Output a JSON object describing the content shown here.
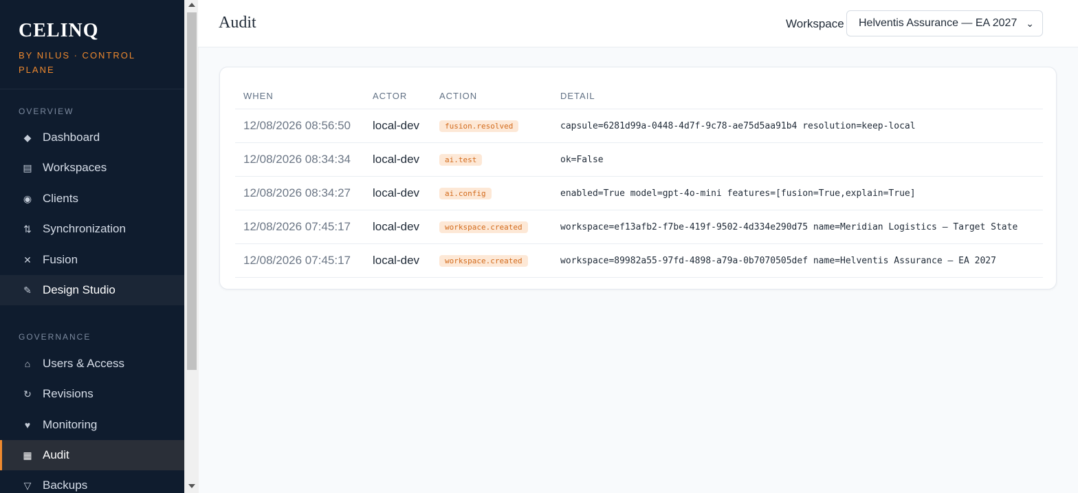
{
  "brand": {
    "title": "CELINQ",
    "subtitle": "BY NILUS · CONTROL PLANE"
  },
  "sidebar": {
    "overview_label": "OVERVIEW",
    "overview_items": [
      {
        "label": "Dashboard",
        "icon": "diamond-icon"
      },
      {
        "label": "Workspaces",
        "icon": "list-icon"
      },
      {
        "label": "Clients",
        "icon": "radio-icon"
      },
      {
        "label": "Synchronization",
        "icon": "sync-arrows-icon"
      },
      {
        "label": "Fusion",
        "icon": "cross-icon"
      },
      {
        "label": "Design Studio",
        "icon": "pencil-icon"
      }
    ],
    "governance_label": "GOVERNANCE",
    "governance_items": [
      {
        "label": "Users & Access",
        "icon": "home-icon"
      },
      {
        "label": "Revisions",
        "icon": "refresh-icon"
      },
      {
        "label": "Monitoring",
        "icon": "heart-icon"
      },
      {
        "label": "Audit",
        "icon": "grid-icon"
      },
      {
        "label": "Backups",
        "icon": "triangle-down-icon"
      }
    ],
    "active_item": "Audit",
    "accent_color": "#f08a2e"
  },
  "header": {
    "title": "Audit",
    "workspace_label": "Workspace",
    "workspace_value": "Helventis Assurance — EA 2027"
  },
  "table": {
    "columns": [
      "WHEN",
      "ACTOR",
      "ACTION",
      "DETAIL"
    ],
    "rows": [
      {
        "when": "12/08/2026 08:56:50",
        "actor": "local-dev",
        "action": "fusion.resolved",
        "detail": "capsule=6281d99a-0448-4d7f-9c78-ae75d5aa91b4 resolution=keep-local"
      },
      {
        "when": "12/08/2026 08:34:34",
        "actor": "local-dev",
        "action": "ai.test",
        "detail": "ok=False"
      },
      {
        "when": "12/08/2026 08:34:27",
        "actor": "local-dev",
        "action": "ai.config",
        "detail": "enabled=True model=gpt-4o-mini features=[fusion=True,explain=True]"
      },
      {
        "when": "12/08/2026 07:45:17",
        "actor": "local-dev",
        "action": "workspace.created",
        "detail": "workspace=ef13afb2-f7be-419f-9502-4d334e290d75 name=Meridian Logistics — Target State"
      },
      {
        "when": "12/08/2026 07:45:17",
        "actor": "local-dev",
        "action": "workspace.created",
        "detail": "workspace=89982a55-97fd-4898-a79a-0b7070505def name=Helventis Assurance — EA 2027"
      }
    ]
  }
}
